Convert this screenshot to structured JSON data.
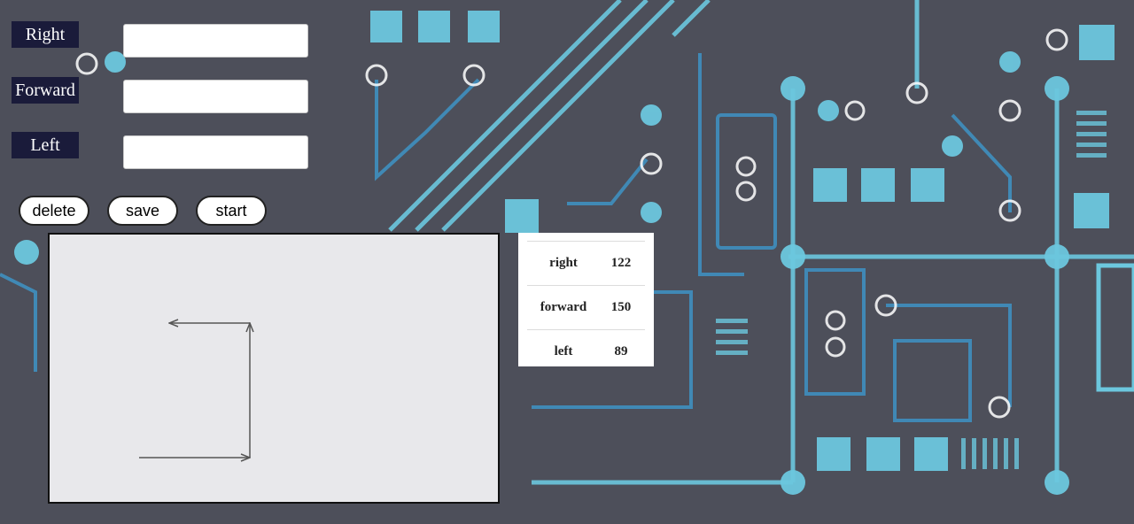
{
  "labels": {
    "right": "Right",
    "forward": "Forward",
    "left": "Left"
  },
  "inputs": {
    "right_value": "",
    "forward_value": "",
    "left_value": ""
  },
  "buttons": {
    "delete": "delete",
    "save": "save",
    "start": "start"
  },
  "table": [
    {
      "key": "right",
      "value": "122"
    },
    {
      "key": "forward",
      "value": "150"
    },
    {
      "key": "left",
      "value": "89"
    }
  ],
  "colors": {
    "background": "#4d4f5a",
    "circuit_light": "#6cc7de",
    "circuit_mid": "#3f8fbf",
    "label_bg": "#1a1b3a"
  }
}
